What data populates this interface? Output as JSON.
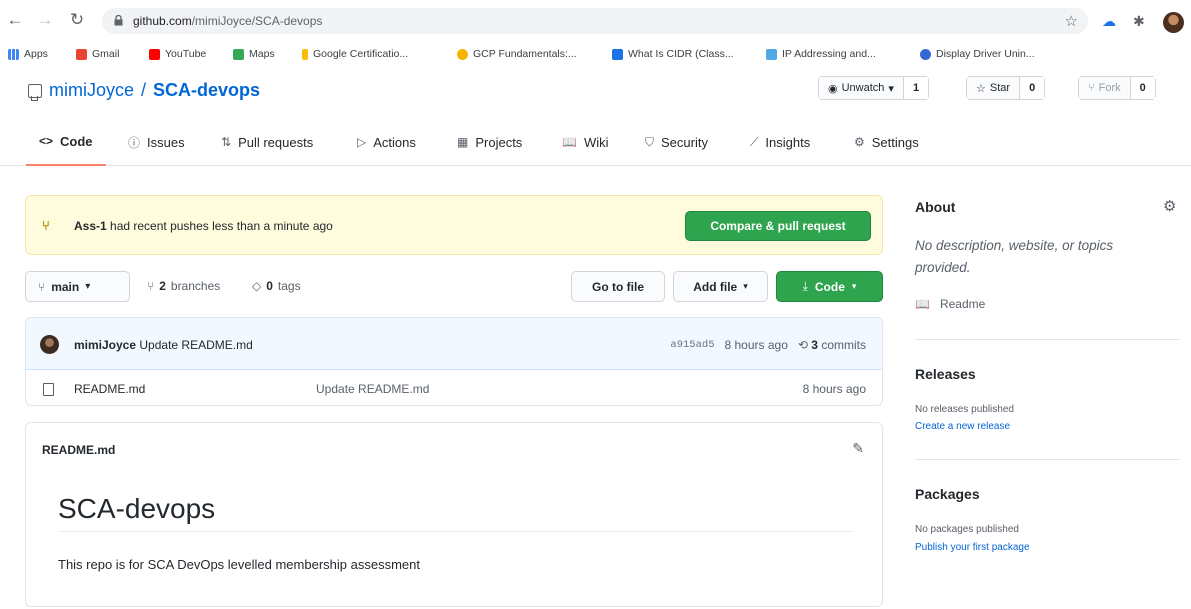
{
  "browser": {
    "url_host": "github.com",
    "url_path": "/mimiJoyce/SCA-devops",
    "bookmarks": [
      {
        "label": "Apps",
        "color": "#4285f4"
      },
      {
        "label": "Gmail",
        "color": "#ea4335"
      },
      {
        "label": "YouTube",
        "color": "#ff0000"
      },
      {
        "label": "Maps",
        "color": "#34a853"
      },
      {
        "label": "Google Certificatio...",
        "color": "#fbbc04"
      },
      {
        "label": "GCP Fundamentals:...",
        "color": "#f4b400"
      },
      {
        "label": "What Is CIDR (Class...",
        "color": "#1a73e8"
      },
      {
        "label": "IP Addressing and...",
        "color": "#4fa8e8"
      },
      {
        "label": "Display Driver Unin...",
        "color": "#3367d6"
      }
    ]
  },
  "repo": {
    "owner": "mimiJoyce",
    "separator": "/",
    "name": "SCA-devops",
    "unwatch_label": "Unwatch",
    "unwatch_count": "1",
    "star_label": "Star",
    "star_count": "0",
    "fork_label": "Fork",
    "fork_count": "0"
  },
  "tabs": [
    {
      "label": "Code",
      "icon": "<>"
    },
    {
      "label": "Issues",
      "icon": "ⓘ"
    },
    {
      "label": "Pull requests",
      "icon": "⇅"
    },
    {
      "label": "Actions",
      "icon": "▷"
    },
    {
      "label": "Projects",
      "icon": "▦"
    },
    {
      "label": "Wiki",
      "icon": "📖"
    },
    {
      "label": "Security",
      "icon": "⛉"
    },
    {
      "label": "Insights",
      "icon": "⟋"
    },
    {
      "label": "Settings",
      "icon": "⚙"
    }
  ],
  "flash": {
    "branch": "Ass-1",
    "message": " had recent pushes less than a minute ago",
    "button": "Compare & pull request"
  },
  "toolbar": {
    "branch": "main",
    "branches_count": "2",
    "branches_label": "branches",
    "tags_count": "0",
    "tags_label": "tags",
    "go_to_file": "Go to file",
    "add_file": "Add file",
    "code": "Code"
  },
  "latest_commit": {
    "author": "mimiJoyce",
    "message": "Update README.md",
    "sha": "a915ad5",
    "age": "8 hours ago",
    "commits_count": "3",
    "commits_label": "commits"
  },
  "files": [
    {
      "name": "README.md",
      "message": "Update README.md",
      "age": "8 hours ago"
    }
  ],
  "readme": {
    "file_name": "README.md",
    "heading": "SCA-devops",
    "body": "This repo is for SCA DevOps levelled membership assessment"
  },
  "sidebar": {
    "about_title": "About",
    "about_desc": "No description, website, or topics provided.",
    "readme_link": "Readme",
    "releases_title": "Releases",
    "releases_empty": "No releases published",
    "releases_link": "Create a new release",
    "packages_title": "Packages",
    "packages_empty": "No packages published",
    "packages_link": "Publish your first package"
  },
  "colors": {
    "accent_link": "#0366d6",
    "primary_green": "#2ea44f",
    "flash_bg": "#fffbdd",
    "active_tab": "#f9826c"
  }
}
